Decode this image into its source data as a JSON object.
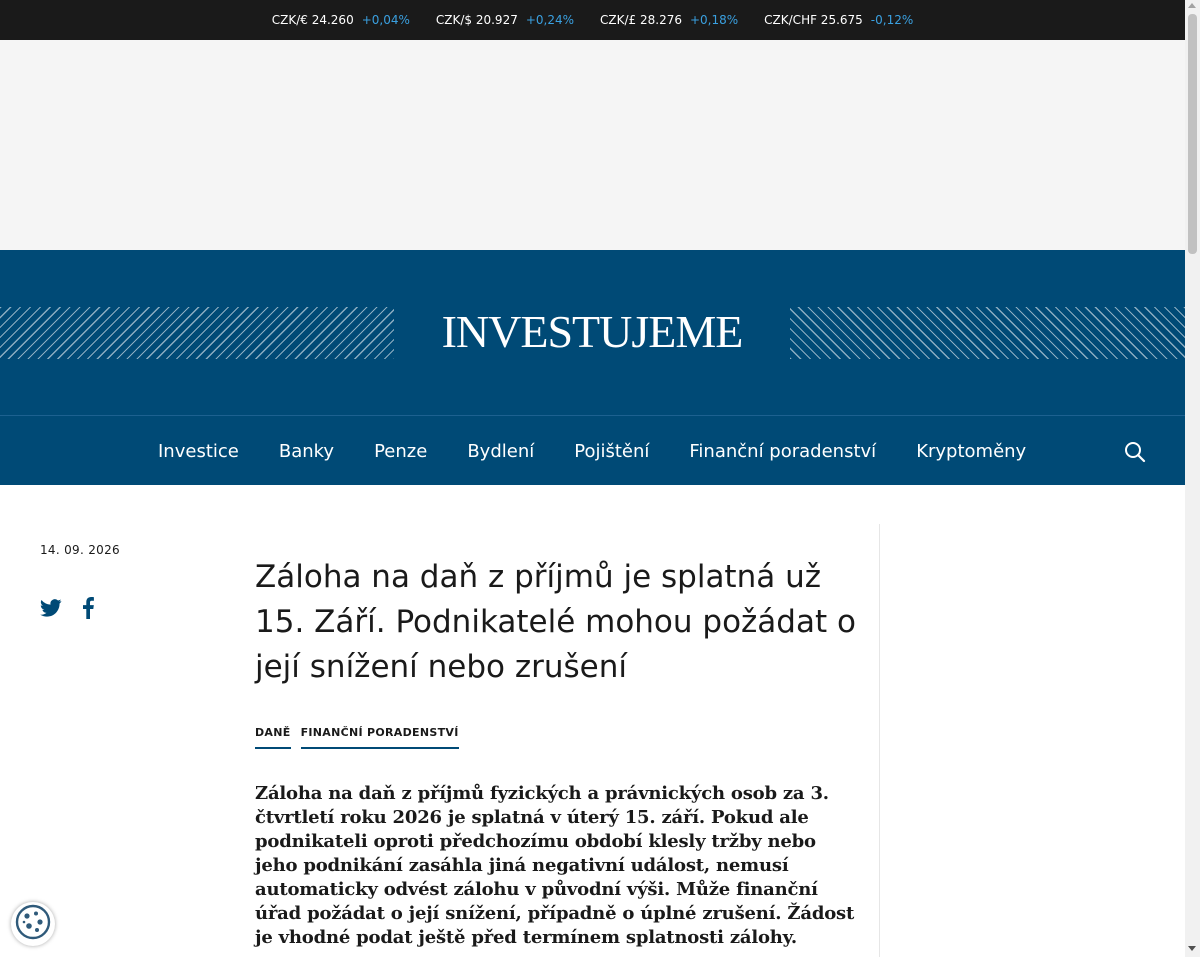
{
  "ticker": {
    "rates": [
      {
        "pair": "CZK/€ 24.260",
        "change": "+0,04%",
        "direction": "up"
      },
      {
        "pair": "CZK/$ 20.927",
        "change": "+0,24%",
        "direction": "up"
      },
      {
        "pair": "CZK/£ 28.276",
        "change": "+0,18%",
        "direction": "up"
      },
      {
        "pair": "CZK/CHF 25.675",
        "change": "-0,12%",
        "direction": "down"
      }
    ]
  },
  "header": {
    "logo": "INVESTUJEME",
    "brand_color": "#004a76"
  },
  "nav": {
    "items": [
      "Investice",
      "Banky",
      "Penze",
      "Bydlení",
      "Pojištění",
      "Finanční poradenství",
      "Kryptoměny"
    ],
    "search_icon": "search-icon"
  },
  "article": {
    "date": "14. 09. 2026",
    "title": "Záloha na daň z příjmů je splatná už 15. Září. Podnikatelé mohou požádat o její snížení nebo zrušení",
    "tags": [
      "DANĚ",
      "FINANČNÍ PORADENSTVÍ"
    ],
    "lead": "Záloha na daň z příjmů fyzických a právnických osob za 3. čtvrtletí roku 2026 je splatná v úterý 15. září. Pokud ale podnikateli oproti předchozímu období klesly tržby nebo jeho podnikání zasáhla jiná negativní událost, nemusí automaticky odvést zálohu v původní výši. Může finanční úřad požádat o její snížení, případně o úplné zrušení. Žádost je vhodné podat ještě před termínem splatnosti zálohy."
  },
  "share": {
    "icons": [
      "twitter-icon",
      "facebook-icon"
    ]
  },
  "cookie": {
    "icon": "cookie-icon"
  }
}
